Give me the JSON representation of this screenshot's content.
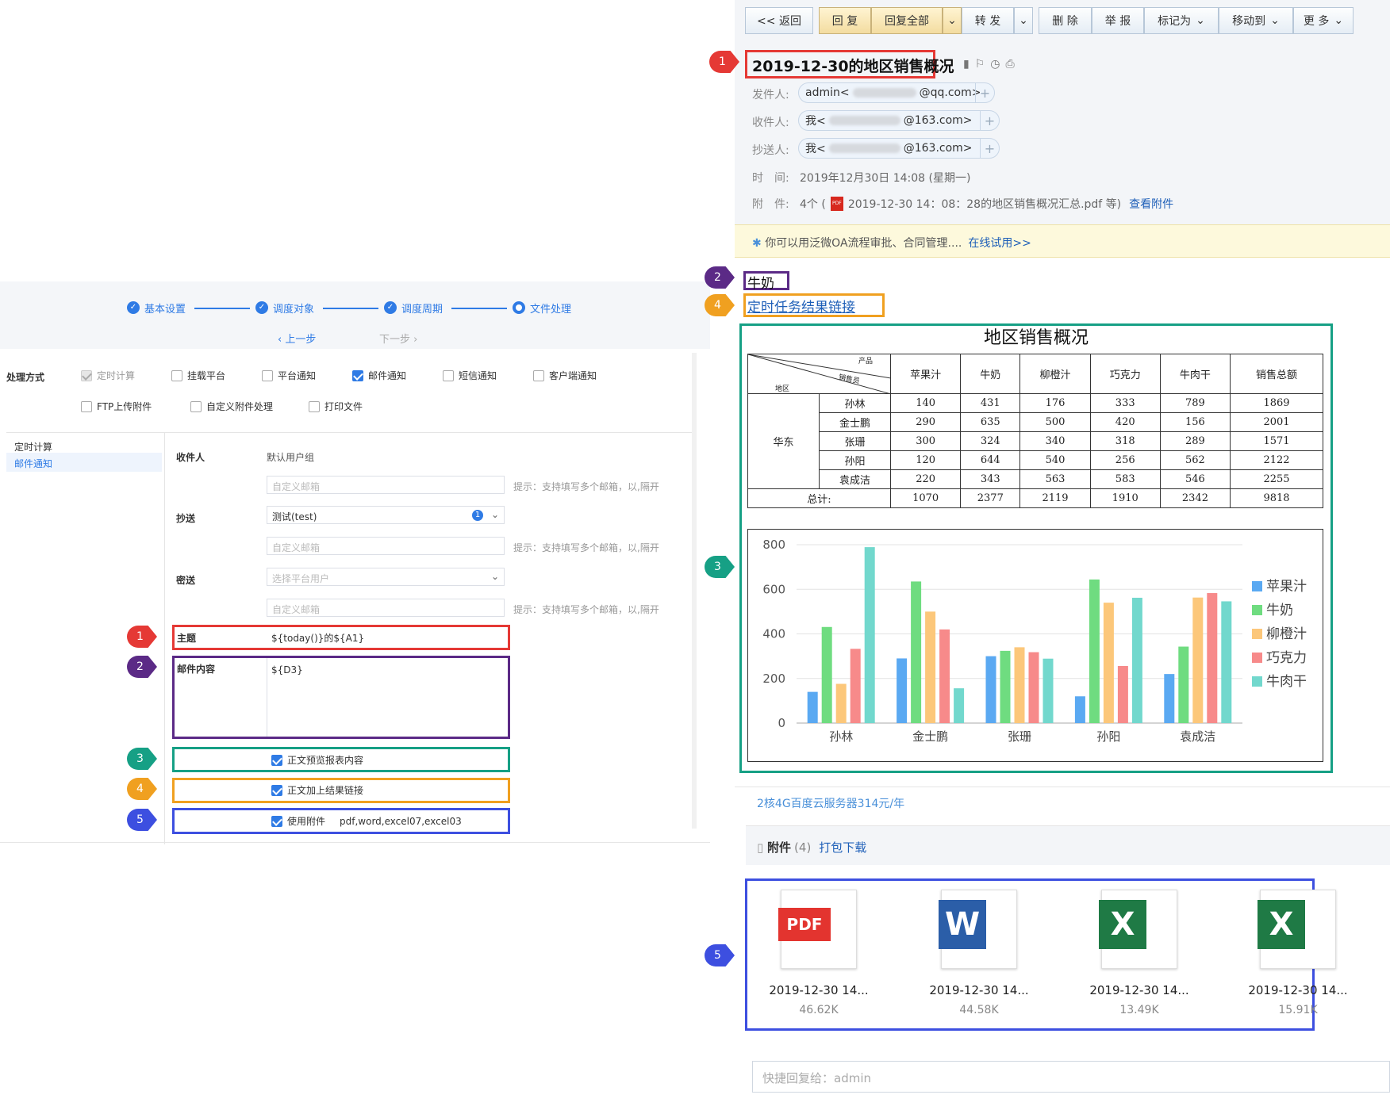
{
  "wizard": {
    "steps": [
      "基本设置",
      "调度对象",
      "调度周期",
      "文件处理"
    ],
    "prev": "上一步",
    "next": "下一步"
  },
  "processing": {
    "label": "处理方式",
    "options": [
      "定时计算",
      "挂载平台",
      "平台通知",
      "邮件通知",
      "短信通知",
      "客户端通知",
      "FTP上传附件",
      "自定义附件处理",
      "打印文件"
    ]
  },
  "side_menu": [
    "定时计算",
    "邮件通知"
  ],
  "form": {
    "recipient_label": "收件人",
    "recipient_value": "默认用户组",
    "custom_email_placeholder": "自定义邮箱",
    "hint": "提示：支持填写多个邮箱，以,隔开",
    "cc_label": "抄送",
    "cc_value": "测试(test)",
    "cc_badge": "1",
    "bcc_label": "密送",
    "bcc_placeholder": "选择平台用户",
    "subject_label": "主题",
    "subject_value": "${today()}的${A1}",
    "body_label": "邮件内容",
    "body_value": "${D3}",
    "preview_label": "正文预览报表内容",
    "link_label": "正文加上结果链接",
    "attach_label": "使用附件",
    "attach_formats": "pdf,word,excel07,excel03"
  },
  "markers": [
    "1",
    "2",
    "3",
    "4",
    "5"
  ],
  "toolbar": {
    "back": "<< 返回",
    "reply": "回 复",
    "reply_all": "回复全部",
    "forward": "转 发",
    "delete": "删 除",
    "report": "举 报",
    "mark_as": "标记为",
    "move_to": "移动到",
    "more": "更 多"
  },
  "mail": {
    "subject": "2019-12-30的地区销售概况",
    "from_label": "发件人:",
    "from_name": "admin<",
    "from_domain": "@qq.com>",
    "to_label": "收件人:",
    "to_name": "我<",
    "to_domain": "@163.com>",
    "cc_label": "抄送人:",
    "cc_name": "我<",
    "cc_domain": "@163.com>",
    "time_label": "时　间:",
    "time_value": "2019年12月30日 14:08 (星期一)",
    "attach_label": "附　件:",
    "attach_count": "4个 (",
    "attach_name": "2019-12-30 14：08：28的地区销售概况汇总.pdf 等)",
    "attach_link": "查看附件",
    "banner_text": "你可以用泛微OA流程审批、合同管理....",
    "banner_link": "在线试用>>",
    "body_text": "牛奶",
    "body_link": "定时任务结果链接",
    "ad_link": "2核4G百度云服务器314元/年",
    "att_section_title": "附件",
    "att_section_count": "(4)",
    "att_section_download": "打包下载",
    "quick_reply": "快捷回复给：admin"
  },
  "report_title": "地区销售概况",
  "table": {
    "header_product": "产品",
    "header_sales": "销售员",
    "header_region": "地区",
    "products": [
      "苹果汁",
      "牛奶",
      "柳橙汁",
      "巧克力",
      "牛肉干",
      "销售总额"
    ],
    "region": "华东",
    "rows": [
      {
        "name": "孙林",
        "values": [
          "140",
          "431",
          "176",
          "333",
          "789",
          "1869"
        ]
      },
      {
        "name": "金士鹏",
        "values": [
          "290",
          "635",
          "500",
          "420",
          "156",
          "2001"
        ]
      },
      {
        "name": "张珊",
        "values": [
          "300",
          "324",
          "340",
          "318",
          "289",
          "1571"
        ]
      },
      {
        "name": "孙阳",
        "values": [
          "120",
          "644",
          "540",
          "256",
          "562",
          "2122"
        ]
      },
      {
        "name": "袁成洁",
        "values": [
          "220",
          "343",
          "563",
          "583",
          "546",
          "2255"
        ]
      }
    ],
    "total_label": "总计:",
    "totals": [
      "1070",
      "2377",
      "2119",
      "1910",
      "2342",
      "9818"
    ]
  },
  "chart_data": {
    "type": "bar",
    "categories": [
      "孙林",
      "金士鹏",
      "张珊",
      "孙阳",
      "袁成洁"
    ],
    "series": [
      {
        "name": "苹果汁",
        "color": "#5aa9f2",
        "values": [
          140,
          290,
          300,
          120,
          220
        ]
      },
      {
        "name": "牛奶",
        "color": "#6fdc80",
        "values": [
          431,
          635,
          324,
          644,
          343
        ]
      },
      {
        "name": "柳橙汁",
        "color": "#fcc77a",
        "values": [
          176,
          500,
          340,
          540,
          563
        ]
      },
      {
        "name": "巧克力",
        "color": "#f78a8a",
        "values": [
          333,
          420,
          318,
          256,
          583
        ]
      },
      {
        "name": "牛肉干",
        "color": "#72d8cd",
        "values": [
          789,
          156,
          289,
          562,
          546
        ]
      }
    ],
    "ylim": [
      0,
      800
    ],
    "yticks": [
      0,
      200,
      400,
      600,
      800
    ],
    "grid": true,
    "legend": "right"
  },
  "attachments": [
    {
      "name": "2019-12-30 14...",
      "size": "46.62K",
      "icon": "pdf-icon",
      "color": "#e3342f",
      "glyph": "PDF"
    },
    {
      "name": "2019-12-30 14...",
      "size": "44.58K",
      "icon": "word-icon",
      "color": "#2b5ea8",
      "glyph": "W"
    },
    {
      "name": "2019-12-30 14...",
      "size": "13.49K",
      "icon": "excel-icon",
      "color": "#1f7a45",
      "glyph": "X"
    },
    {
      "name": "2019-12-30 14...",
      "size": "15.91K",
      "icon": "excel-icon",
      "color": "#1f7a45",
      "glyph": "X"
    }
  ]
}
